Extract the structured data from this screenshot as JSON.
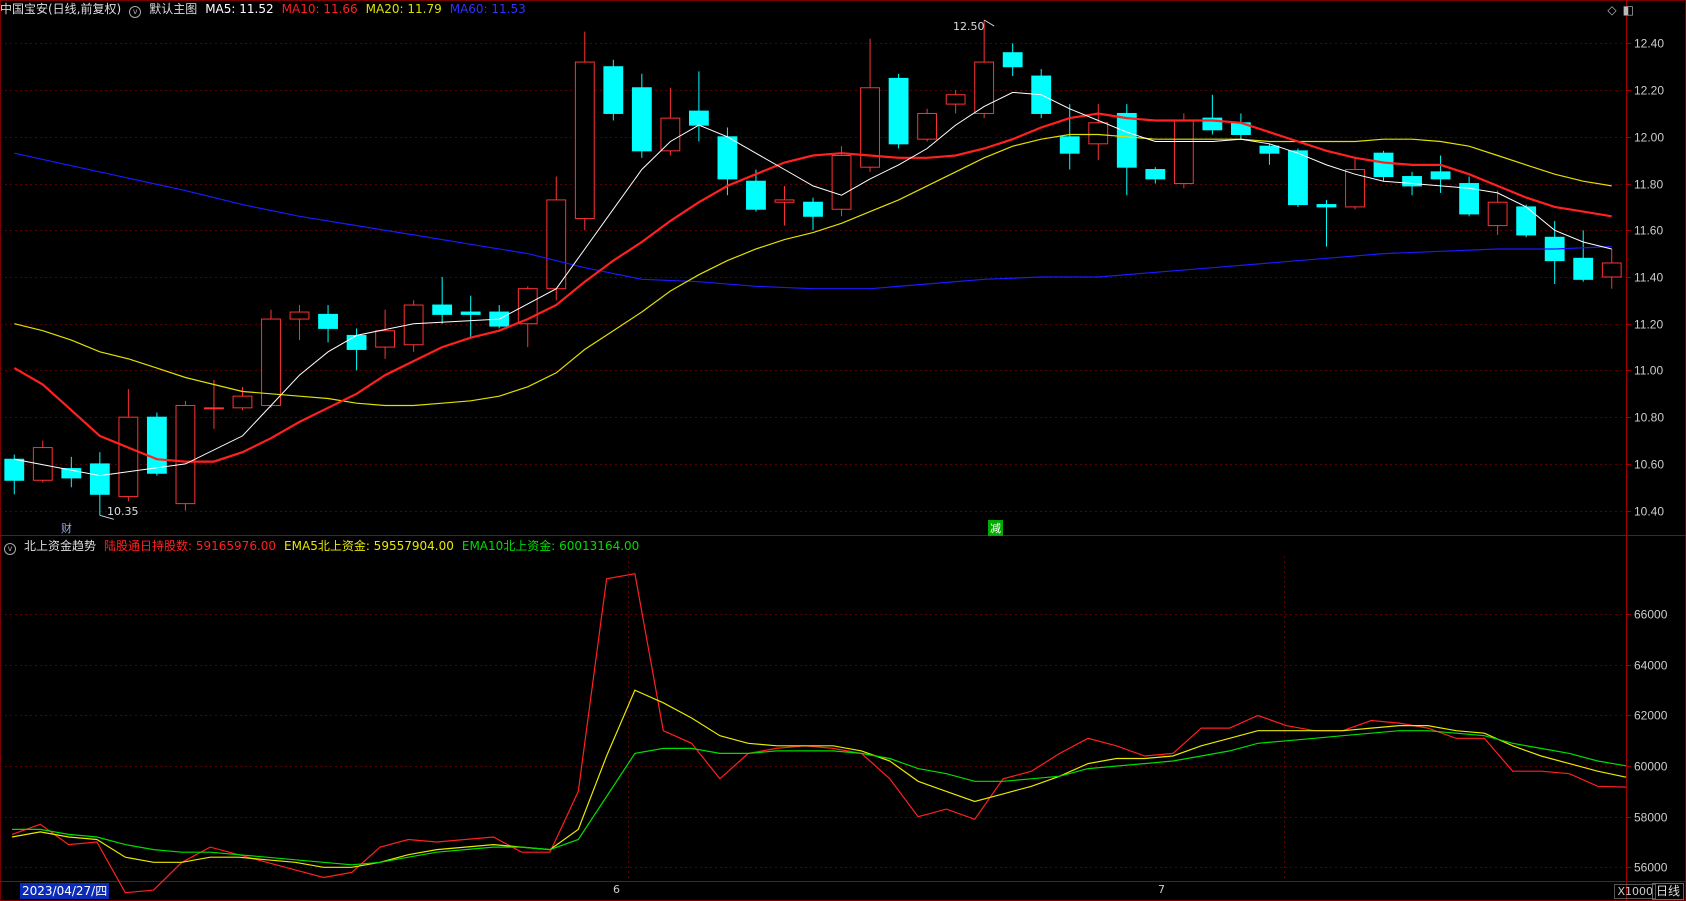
{
  "header_main": {
    "title": "中国宝安(日线,前复权)",
    "main_label": "默认主图",
    "ma5": "MA5: 11.52",
    "ma10": "MA10: 11.66",
    "ma20": "MA20: 11.79",
    "ma60": "MA60: 11.53"
  },
  "header_sub": {
    "title": "北上资金趋势",
    "hold": "陆股通日持股数: 59165976.00",
    "ema5": "EMA5北上资金: 59557904.00",
    "ema10": "EMA10北上资金: 60013164.00"
  },
  "markers": {
    "cai": "财",
    "jian": "减",
    "high": "12.50",
    "low": "10.35"
  },
  "footer": {
    "date": "2023/04/27/四",
    "month6": "6",
    "month7": "7",
    "unit": "X1000",
    "period": "日线"
  },
  "colors": {
    "up": "#ff3232",
    "down": "#00ffff",
    "ma5": "#ffffff",
    "ma10": "#ff2020",
    "ma20": "#e0e000",
    "ma60": "#1a1aff",
    "hold": "#ff2020",
    "ema5": "#e8e800",
    "ema10": "#00dd00"
  },
  "chart_data": [
    {
      "type": "candlestick",
      "ylim": [
        10.3,
        12.5
      ],
      "yticks": [
        10.4,
        10.6,
        10.8,
        11.0,
        11.2,
        11.4,
        11.6,
        11.8,
        12.0,
        12.2,
        12.4
      ],
      "candles": [
        [
          10.62,
          10.53,
          10.64,
          10.47
        ],
        [
          10.53,
          10.67,
          10.7,
          10.52
        ],
        [
          10.58,
          10.54,
          10.63,
          10.5
        ],
        [
          10.6,
          10.47,
          10.65,
          10.38
        ],
        [
          10.46,
          10.8,
          10.92,
          10.44
        ],
        [
          10.8,
          10.56,
          10.82,
          10.55
        ],
        [
          10.43,
          10.85,
          10.87,
          10.4
        ],
        [
          10.84,
          10.84,
          10.96,
          10.75
        ],
        [
          10.84,
          10.89,
          10.93,
          10.83
        ],
        [
          10.85,
          11.22,
          11.26,
          10.84
        ],
        [
          11.22,
          11.25,
          11.28,
          11.13
        ],
        [
          11.24,
          11.18,
          11.28,
          11.12
        ],
        [
          11.15,
          11.09,
          11.18,
          11.0
        ],
        [
          11.1,
          11.17,
          11.26,
          11.05
        ],
        [
          11.11,
          11.28,
          11.3,
          11.08
        ],
        [
          11.28,
          11.24,
          11.4,
          11.2
        ],
        [
          11.25,
          11.24,
          11.32,
          11.14
        ],
        [
          11.25,
          11.19,
          11.28,
          11.18
        ],
        [
          11.2,
          11.35,
          11.36,
          11.1
        ],
        [
          11.35,
          11.73,
          11.83,
          11.3
        ],
        [
          11.65,
          12.32,
          12.45,
          11.6
        ],
        [
          12.3,
          12.1,
          12.33,
          12.07
        ],
        [
          12.21,
          11.94,
          12.27,
          11.91
        ],
        [
          11.94,
          12.08,
          12.21,
          11.92
        ],
        [
          12.11,
          12.05,
          12.28,
          11.98
        ],
        [
          12.0,
          11.82,
          12.04,
          11.75
        ],
        [
          11.81,
          11.69,
          11.86,
          11.68
        ],
        [
          11.72,
          11.73,
          11.79,
          11.62
        ],
        [
          11.72,
          11.66,
          11.74,
          11.6
        ],
        [
          11.69,
          11.92,
          11.96,
          11.66
        ],
        [
          11.87,
          12.21,
          12.42,
          11.85
        ],
        [
          12.25,
          11.97,
          12.27,
          11.95
        ],
        [
          11.99,
          12.1,
          12.12,
          11.98
        ],
        [
          12.14,
          12.18,
          12.2,
          12.1
        ],
        [
          12.1,
          12.32,
          12.5,
          12.08
        ],
        [
          12.36,
          12.3,
          12.4,
          12.26
        ],
        [
          12.26,
          12.1,
          12.29,
          12.08
        ],
        [
          12.0,
          11.93,
          12.14,
          11.86
        ],
        [
          11.97,
          12.06,
          12.14,
          11.9
        ],
        [
          12.1,
          11.87,
          12.14,
          11.75
        ],
        [
          11.86,
          11.82,
          11.87,
          11.8
        ],
        [
          11.8,
          12.07,
          12.1,
          11.78
        ],
        [
          12.08,
          12.03,
          12.18,
          12.01
        ],
        [
          12.06,
          12.01,
          12.1,
          11.99
        ],
        [
          11.96,
          11.93,
          11.97,
          11.88
        ],
        [
          11.94,
          11.71,
          11.95,
          11.7
        ],
        [
          11.71,
          11.7,
          11.73,
          11.53
        ],
        [
          11.7,
          11.86,
          11.91,
          11.69
        ],
        [
          11.93,
          11.83,
          11.94,
          11.81
        ],
        [
          11.83,
          11.79,
          11.85,
          11.75
        ],
        [
          11.85,
          11.82,
          11.92,
          11.76
        ],
        [
          11.8,
          11.67,
          11.83,
          11.66
        ],
        [
          11.62,
          11.72,
          11.77,
          11.58
        ],
        [
          11.7,
          11.58,
          11.71,
          11.57
        ],
        [
          11.57,
          11.47,
          11.64,
          11.37
        ],
        [
          11.48,
          11.39,
          11.6,
          11.38
        ],
        [
          11.4,
          11.46,
          11.52,
          11.35
        ]
      ],
      "ma5": [
        [
          0,
          10.62
        ],
        [
          3,
          10.55
        ],
        [
          6,
          10.6
        ],
        [
          8,
          10.72
        ],
        [
          9,
          10.85
        ],
        [
          10,
          10.98
        ],
        [
          11,
          11.08
        ],
        [
          12,
          11.15
        ],
        [
          14,
          11.2
        ],
        [
          17,
          11.22
        ],
        [
          19,
          11.35
        ],
        [
          20,
          11.52
        ],
        [
          21,
          11.69
        ],
        [
          22,
          11.86
        ],
        [
          23,
          11.98
        ],
        [
          24,
          12.05
        ],
        [
          25,
          12.0
        ],
        [
          26,
          11.93
        ],
        [
          27,
          11.86
        ],
        [
          28,
          11.79
        ],
        [
          29,
          11.75
        ],
        [
          30,
          11.82
        ],
        [
          31,
          11.88
        ],
        [
          32,
          11.95
        ],
        [
          33,
          12.05
        ],
        [
          34,
          12.13
        ],
        [
          35,
          12.19
        ],
        [
          36,
          12.18
        ],
        [
          37,
          12.12
        ],
        [
          38,
          12.07
        ],
        [
          39,
          12.02
        ],
        [
          40,
          11.98
        ],
        [
          41,
          11.98
        ],
        [
          42,
          11.98
        ],
        [
          43,
          11.99
        ],
        [
          44,
          11.97
        ],
        [
          45,
          11.93
        ],
        [
          46,
          11.88
        ],
        [
          47,
          11.84
        ],
        [
          48,
          11.81
        ],
        [
          49,
          11.8
        ],
        [
          50,
          11.79
        ],
        [
          51,
          11.78
        ],
        [
          52,
          11.76
        ],
        [
          53,
          11.7
        ],
        [
          54,
          11.6
        ],
        [
          55,
          11.55
        ],
        [
          56,
          11.52
        ]
      ],
      "ma10": [
        [
          0,
          11.01
        ],
        [
          1,
          10.94
        ],
        [
          2,
          10.83
        ],
        [
          3,
          10.72
        ],
        [
          4,
          10.67
        ],
        [
          5,
          10.62
        ],
        [
          6,
          10.61
        ],
        [
          7,
          10.61
        ],
        [
          8,
          10.65
        ],
        [
          9,
          10.71
        ],
        [
          10,
          10.78
        ],
        [
          11,
          10.84
        ],
        [
          12,
          10.9
        ],
        [
          13,
          10.98
        ],
        [
          14,
          11.04
        ],
        [
          15,
          11.1
        ],
        [
          16,
          11.14
        ],
        [
          17,
          11.17
        ],
        [
          18,
          11.22
        ],
        [
          19,
          11.28
        ],
        [
          20,
          11.38
        ],
        [
          21,
          11.47
        ],
        [
          22,
          11.55
        ],
        [
          23,
          11.64
        ],
        [
          24,
          11.72
        ],
        [
          25,
          11.79
        ],
        [
          26,
          11.84
        ],
        [
          27,
          11.89
        ],
        [
          28,
          11.92
        ],
        [
          29,
          11.93
        ],
        [
          30,
          11.92
        ],
        [
          31,
          11.91
        ],
        [
          32,
          11.91
        ],
        [
          33,
          11.92
        ],
        [
          34,
          11.95
        ],
        [
          35,
          11.99
        ],
        [
          36,
          12.04
        ],
        [
          37,
          12.08
        ],
        [
          38,
          12.1
        ],
        [
          39,
          12.08
        ],
        [
          40,
          12.07
        ],
        [
          41,
          12.07
        ],
        [
          42,
          12.07
        ],
        [
          43,
          12.06
        ],
        [
          44,
          12.02
        ],
        [
          45,
          11.98
        ],
        [
          46,
          11.94
        ],
        [
          47,
          11.91
        ],
        [
          48,
          11.89
        ],
        [
          49,
          11.88
        ],
        [
          50,
          11.88
        ],
        [
          51,
          11.84
        ],
        [
          52,
          11.79
        ],
        [
          53,
          11.74
        ],
        [
          54,
          11.7
        ],
        [
          55,
          11.68
        ],
        [
          56,
          11.66
        ]
      ],
      "ma20": [
        [
          0,
          11.2
        ],
        [
          1,
          11.17
        ],
        [
          2,
          11.13
        ],
        [
          3,
          11.08
        ],
        [
          4,
          11.05
        ],
        [
          5,
          11.01
        ],
        [
          6,
          10.97
        ],
        [
          7,
          10.94
        ],
        [
          8,
          10.91
        ],
        [
          9,
          10.9
        ],
        [
          10,
          10.89
        ],
        [
          11,
          10.88
        ],
        [
          12,
          10.86
        ],
        [
          13,
          10.85
        ],
        [
          14,
          10.85
        ],
        [
          15,
          10.86
        ],
        [
          16,
          10.87
        ],
        [
          17,
          10.89
        ],
        [
          18,
          10.93
        ],
        [
          19,
          10.99
        ],
        [
          20,
          11.09
        ],
        [
          21,
          11.17
        ],
        [
          22,
          11.25
        ],
        [
          23,
          11.34
        ],
        [
          24,
          11.41
        ],
        [
          25,
          11.47
        ],
        [
          26,
          11.52
        ],
        [
          27,
          11.56
        ],
        [
          28,
          11.59
        ],
        [
          29,
          11.63
        ],
        [
          30,
          11.68
        ],
        [
          31,
          11.73
        ],
        [
          32,
          11.79
        ],
        [
          33,
          11.85
        ],
        [
          34,
          11.91
        ],
        [
          35,
          11.96
        ],
        [
          36,
          11.99
        ],
        [
          37,
          12.01
        ],
        [
          38,
          12.01
        ],
        [
          39,
          12.0
        ],
        [
          40,
          11.99
        ],
        [
          41,
          11.99
        ],
        [
          42,
          11.99
        ],
        [
          43,
          11.99
        ],
        [
          44,
          11.98
        ],
        [
          45,
          11.98
        ],
        [
          46,
          11.98
        ],
        [
          47,
          11.98
        ],
        [
          48,
          11.99
        ],
        [
          49,
          11.99
        ],
        [
          50,
          11.98
        ],
        [
          51,
          11.96
        ],
        [
          52,
          11.92
        ],
        [
          53,
          11.88
        ],
        [
          54,
          11.84
        ],
        [
          55,
          11.81
        ],
        [
          56,
          11.79
        ]
      ],
      "ma60": [
        [
          0,
          11.93
        ],
        [
          3,
          11.85
        ],
        [
          6,
          11.77
        ],
        [
          8,
          11.71
        ],
        [
          10,
          11.66
        ],
        [
          12,
          11.62
        ],
        [
          14,
          11.58
        ],
        [
          16,
          11.54
        ],
        [
          18,
          11.5
        ],
        [
          20,
          11.44
        ],
        [
          22,
          11.39
        ],
        [
          24,
          11.38
        ],
        [
          26,
          11.36
        ],
        [
          28,
          11.35
        ],
        [
          30,
          11.35
        ],
        [
          32,
          11.37
        ],
        [
          34,
          11.39
        ],
        [
          36,
          11.4
        ],
        [
          38,
          11.4
        ],
        [
          40,
          11.42
        ],
        [
          42,
          11.44
        ],
        [
          44,
          11.46
        ],
        [
          46,
          11.48
        ],
        [
          48,
          11.5
        ],
        [
          50,
          11.51
        ],
        [
          52,
          11.52
        ],
        [
          54,
          11.52
        ],
        [
          56,
          11.53
        ]
      ]
    },
    {
      "type": "line",
      "ylim": [
        55500,
        68300
      ],
      "yticks": [
        56000,
        58000,
        60000,
        62000,
        64000,
        66000
      ],
      "series": [
        {
          "name": "陆股通日持股数",
          "values": [
            57300,
            57700,
            56900,
            57000,
            55000,
            55100,
            56200,
            56800,
            56500,
            56200,
            55900,
            55600,
            55800,
            56800,
            57100,
            57000,
            57100,
            57200,
            56600,
            56600,
            59000,
            67400,
            67600,
            61400,
            60900,
            59500,
            60500,
            60700,
            60800,
            60700,
            60500,
            59500,
            58000,
            58300,
            57900,
            59500,
            59800,
            60500,
            61100,
            60800,
            60400,
            60500,
            61500,
            61500,
            62000,
            61600,
            61400,
            61400,
            61800,
            61700,
            61500,
            61100,
            61100,
            59800,
            59800,
            59700,
            59200,
            59170
          ]
        },
        {
          "name": "EMA5北上资金",
          "values": [
            57200,
            57400,
            57200,
            57100,
            56400,
            56200,
            56200,
            56400,
            56400,
            56300,
            56200,
            56000,
            56000,
            56200,
            56500,
            56700,
            56800,
            56900,
            56800,
            56700,
            57500,
            60400,
            63000,
            62500,
            61900,
            61200,
            60900,
            60800,
            60800,
            60800,
            60600,
            60200,
            59400,
            59000,
            58600,
            58900,
            59200,
            59600,
            60100,
            60300,
            60300,
            60400,
            60800,
            61100,
            61400,
            61400,
            61400,
            61400,
            61500,
            61600,
            61600,
            61400,
            61300,
            60800,
            60400,
            60100,
            59800,
            59560
          ]
        },
        {
          "name": "EMA10北上资金",
          "values": [
            57500,
            57500,
            57300,
            57200,
            56900,
            56700,
            56600,
            56600,
            56500,
            56400,
            56300,
            56200,
            56100,
            56200,
            56400,
            56600,
            56700,
            56800,
            56800,
            56700,
            57100,
            58800,
            60500,
            60700,
            60700,
            60500,
            60500,
            60600,
            60600,
            60600,
            60500,
            60300,
            59900,
            59700,
            59400,
            59400,
            59500,
            59600,
            59900,
            60000,
            60100,
            60200,
            60400,
            60600,
            60900,
            61000,
            61100,
            61200,
            61300,
            61400,
            61400,
            61300,
            61200,
            60900,
            60700,
            60500,
            60200,
            60013
          ]
        }
      ]
    }
  ]
}
